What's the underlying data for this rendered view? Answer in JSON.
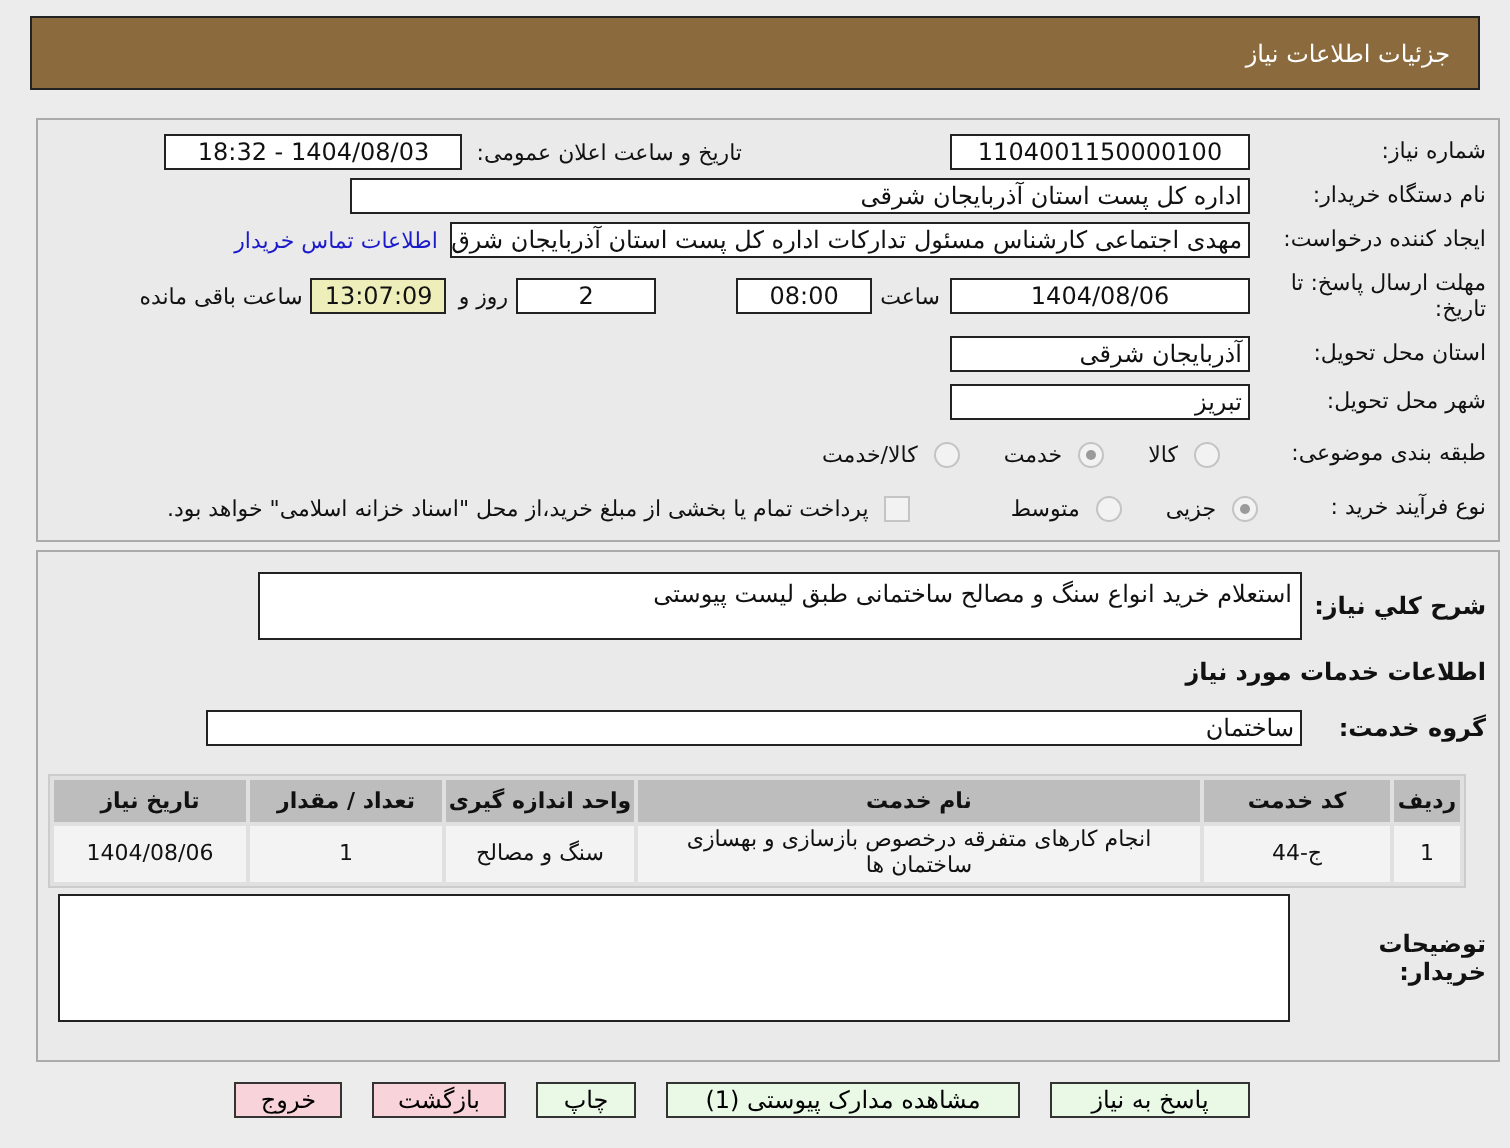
{
  "page_title": "جزئیات اطلاعات نیاز",
  "need_number": {
    "label": "شماره نیاز:",
    "value": "1104001150000100"
  },
  "announce": {
    "label": "تاریخ و ساعت اعلان عمومی:",
    "value": "1404/08/03 - 18:32"
  },
  "buyer": {
    "label": "نام دستگاه خریدار:",
    "value": "اداره کل پست استان آذربایجان شرقی"
  },
  "creator": {
    "label": "ایجاد کننده درخواست:",
    "value": "مهدی اجتماعی کارشناس مسئول تدارکات اداره کل پست استان آذربایجان شرق",
    "link": "اطلاعات تماس خریدار"
  },
  "deadline": {
    "label": "مهلت ارسال پاسخ: تا تاریخ:",
    "date": "1404/08/06",
    "time_label": "ساعت",
    "time": "08:00",
    "days": "2",
    "days_label": "روز و",
    "remaining": "13:07:09",
    "remaining_label": "ساعت باقی مانده"
  },
  "province": {
    "label": "استان محل تحویل:",
    "value": "آذربایجان شرقی"
  },
  "city": {
    "label": "شهر محل تحویل:",
    "value": "تبریز"
  },
  "category": {
    "label": "طبقه بندی موضوعی:",
    "options": [
      {
        "label": "کالا",
        "selected": false
      },
      {
        "label": "خدمت",
        "selected": true
      },
      {
        "label": "کالا/خدمت",
        "selected": false
      }
    ]
  },
  "purchase_type": {
    "label": "نوع فرآیند خرید :",
    "options": [
      {
        "label": "جزیی",
        "selected": true
      },
      {
        "label": "متوسط",
        "selected": false
      }
    ],
    "payment": {
      "label": "پرداخت تمام یا بخشی از مبلغ خرید،از محل \"اسناد خزانه اسلامی\" خواهد بود.",
      "checked": false
    }
  },
  "description": {
    "label": "شرح کلي نیاز:",
    "value": "استعلام خرید انواع سنگ و مصالح ساختمانی طبق لیست پیوستی"
  },
  "services_title": "اطلاعات خدمات مورد نیاز",
  "service_group": {
    "label": "گروه خدمت:",
    "value": "ساختمان"
  },
  "table": {
    "columns": [
      "ردیف",
      "کد خدمت",
      "نام خدمت",
      "واحد اندازه گیری",
      "تعداد / مقدار",
      "تاریخ نیاز"
    ],
    "rows": [
      [
        "1",
        "ج-44",
        "انجام کارهای متفرقه درخصوص بازسازی و بهسازی ساختمان ها",
        "سنگ و مصالح",
        "1",
        "1404/08/06"
      ]
    ]
  },
  "buyer_notes": {
    "label": "توضیحات خریدار:"
  },
  "buttons": [
    {
      "label": "پاسخ به نیاز",
      "kind": "normal"
    },
    {
      "label": "مشاهده مدارک پیوستی (1)",
      "kind": "normal"
    },
    {
      "label": "چاپ",
      "kind": "normal"
    },
    {
      "label": "بازگشت",
      "kind": "danger"
    },
    {
      "label": "خروج",
      "kind": "danger"
    }
  ]
}
